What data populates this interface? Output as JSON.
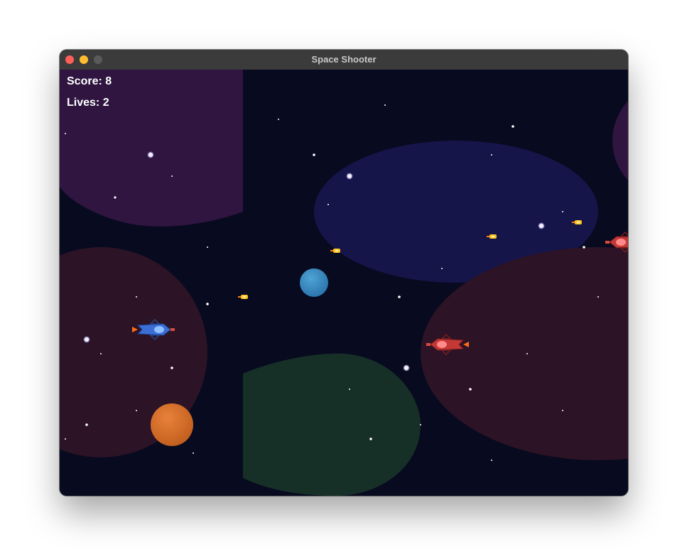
{
  "window": {
    "title": "Space Shooter"
  },
  "hud": {
    "score_text": "Score: 8",
    "lives_text": "Lives: 2"
  },
  "colors": {
    "space": "#080a1f",
    "nebula_purple": "#2f1540",
    "nebula_blue": "#15154a",
    "nebula_red": "#2c1326",
    "nebula_green": "#163028",
    "player_ship": "#3b6fd6",
    "enemy_ship": "#c43838",
    "bullet": "#ffc21a",
    "planet_blue": "#3a8fc6",
    "planet_orange": "#d9702a"
  },
  "entities": {
    "player": {
      "icon": "player-spaceship"
    },
    "enemies": [
      "enemy-spaceship",
      "enemy-spaceship"
    ],
    "bullets": 4,
    "planets": [
      "blue-planet",
      "orange-planet"
    ]
  }
}
